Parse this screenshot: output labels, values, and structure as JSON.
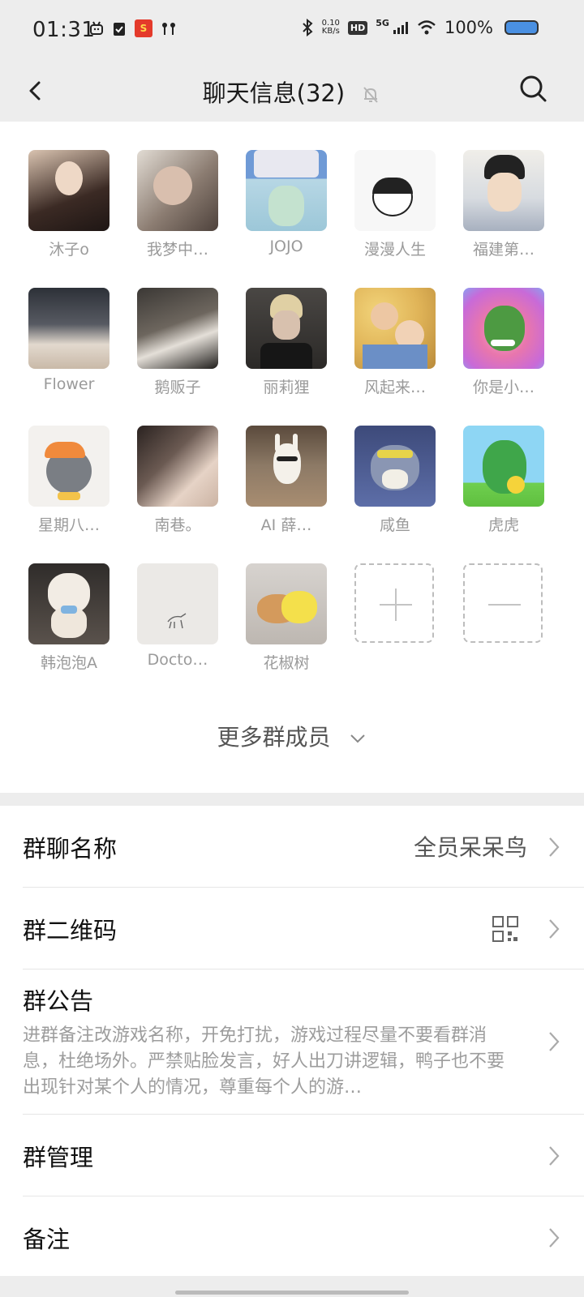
{
  "status_bar": {
    "time": "01:31",
    "net_speed_value": "0.10",
    "net_speed_unit": "KB/s",
    "hd_badge": "HD",
    "network": "5G",
    "battery": "100%",
    "icons": [
      "bilibili-icon",
      "task-check-icon",
      "app-badge-icon",
      "earbuds-icon",
      "bluetooth-icon",
      "signal-icon",
      "wifi-icon",
      "battery-icon"
    ],
    "battery_color": "#4a90e2"
  },
  "header": {
    "title": "聊天信息(32)",
    "back_icon": "back-arrow-icon",
    "mute_icon": "bell-muted-icon",
    "search_icon": "search-icon"
  },
  "members": [
    {
      "name": "沐子o"
    },
    {
      "name": "我梦中…"
    },
    {
      "name": "JOJO"
    },
    {
      "name": "漫漫人生"
    },
    {
      "name": "福建第…"
    },
    {
      "name": "Flower"
    },
    {
      "name": "鹅贩子"
    },
    {
      "name": "丽莉狸"
    },
    {
      "name": "风起来…"
    },
    {
      "name": "你是小…"
    },
    {
      "name": "星期八…"
    },
    {
      "name": "南巷。"
    },
    {
      "name": "AI 薛…"
    },
    {
      "name": "咸鱼"
    },
    {
      "name": "虎虎"
    },
    {
      "name": "韩泡泡A"
    },
    {
      "name": "Docto…"
    },
    {
      "name": "花椒树"
    }
  ],
  "add_member_icon": "plus-icon",
  "remove_member_icon": "minus-icon",
  "more_members": "更多群成员",
  "settings": {
    "group_name_label": "群聊名称",
    "group_name_value": "全员呆呆鸟",
    "qr_label": "群二维码",
    "qr_icon": "qr-code-icon",
    "notice_label": "群公告",
    "notice_text": "进群备注改游戏名称，开免打扰，游戏过程尽量不要看群消息，杜绝场外。严禁贴脸发言，好人出刀讲逻辑，鸭子也不要出现针对某个人的情况，尊重每个人的游…",
    "manage_label": "群管理",
    "remark_label": "备注"
  },
  "colors": {
    "background_gray": "#ededed",
    "divider": "#e6e6e6",
    "secondary_text": "#9a9a9a"
  }
}
